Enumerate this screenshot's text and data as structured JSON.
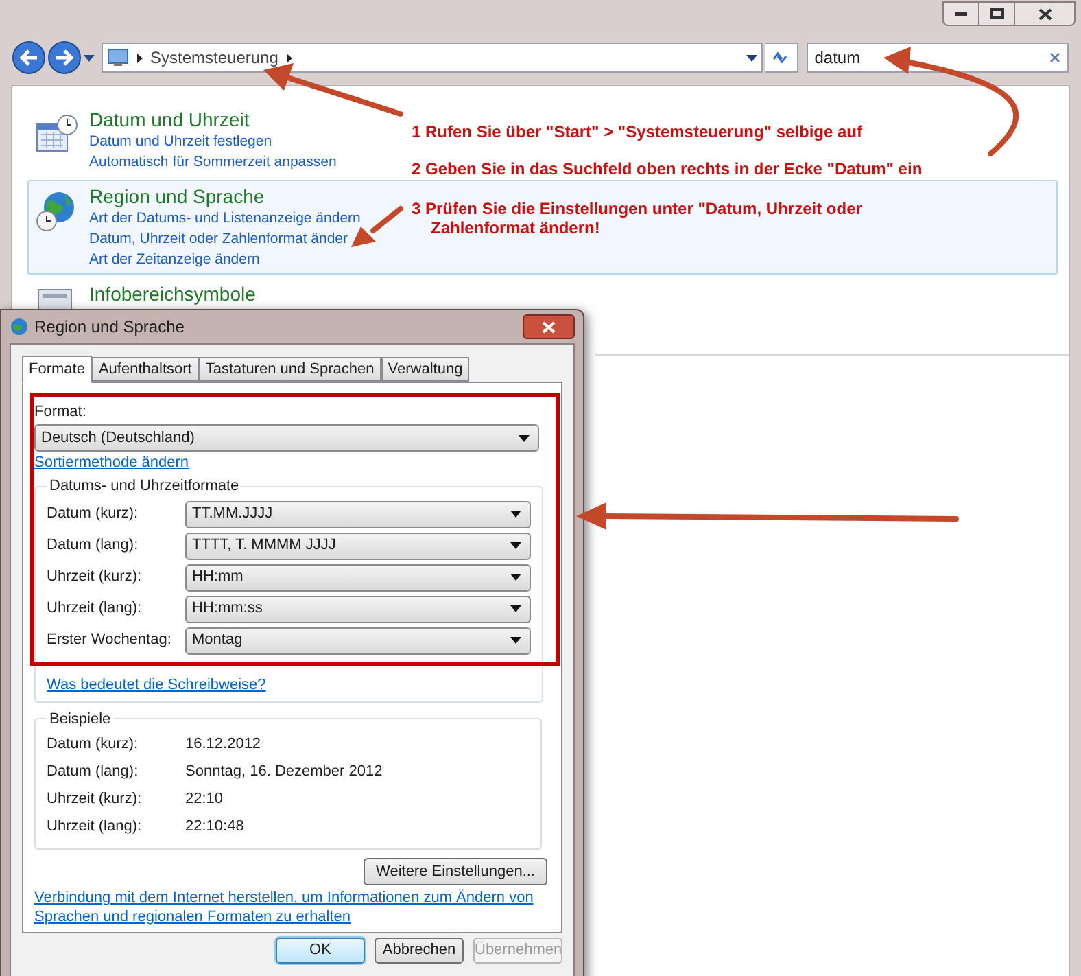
{
  "explorer": {
    "breadcrumb": "Systemsteuerung",
    "search": {
      "value": "datum"
    },
    "items": [
      {
        "title": "Datum und Uhrzeit",
        "selected": false,
        "links": [
          "Datum und Uhrzeit festlegen",
          "Automatisch für Sommerzeit anpassen"
        ]
      },
      {
        "title": "Region und Sprache",
        "selected": true,
        "links": [
          "Art der Datums- und Listenanzeige ändern",
          "Datum, Uhrzeit oder Zahlenformat änder",
          "Art der Zeitanzeige ändern"
        ]
      },
      {
        "title": "Infobereichsymbole",
        "selected": false
      }
    ]
  },
  "annotations": [
    {
      "lines": [
        "1  Rufen Sie über \"Start\" > \"Systemsteuerung\" selbige auf"
      ]
    },
    {
      "lines": [
        "2  Geben Sie in das Suchfeld oben rechts in der Ecke \"Datum\" ein"
      ]
    },
    {
      "lines": [
        "3 Prüfen Sie die Einstellungen unter \"Datum, Uhrzeit oder",
        "Zahlenformat ändern!"
      ]
    }
  ],
  "dialog": {
    "title": "Region und Sprache",
    "tabs": [
      {
        "label": "Formate",
        "selected": true
      },
      {
        "label": "Aufenthaltsort",
        "selected": false
      },
      {
        "label": "Tastaturen und Sprachen",
        "selected": false
      },
      {
        "label": "Verwaltung",
        "selected": false
      }
    ],
    "format_label": "Format:",
    "format_value": "Deutsch (Deutschland)",
    "sort_link": "Sortiermethode ändern",
    "formats_group": {
      "title": "Datums- und Uhrzeitformate",
      "fields": [
        {
          "label": "Datum (kurz):",
          "value": "TT.MM.JJJJ"
        },
        {
          "label": "Datum (lang):",
          "value": "TTTT, T. MMMM JJJJ"
        },
        {
          "label": "Uhrzeit (kurz):",
          "value": "HH:mm"
        },
        {
          "label": "Uhrzeit (lang):",
          "value": "HH:mm:ss"
        },
        {
          "label": "Erster Wochentag:",
          "value": "Montag"
        }
      ],
      "link": "Was bedeutet die Schreibweise?"
    },
    "examples_group": {
      "title": "Beispiele",
      "rows": [
        {
          "label": "Datum (kurz):",
          "value": "16.12.2012"
        },
        {
          "label": "Datum (lang):",
          "value": "Sonntag, 16. Dezember 2012"
        },
        {
          "label": "Uhrzeit (kurz):",
          "value": "22:10"
        },
        {
          "label": "Uhrzeit (lang):",
          "value": "22:10:48"
        }
      ]
    },
    "more_button": "Weitere Einstellungen...",
    "internet_link": "Verbindung mit dem Internet herstellen, um Informationen zum Ändern von Sprachen und regionalen Formaten zu erhalten",
    "buttons": [
      {
        "label": "OK",
        "default": true,
        "disabled": false
      },
      {
        "label": "Abbrechen",
        "default": false,
        "disabled": false
      },
      {
        "label": "Übernehmen",
        "default": false,
        "disabled": true
      }
    ]
  }
}
